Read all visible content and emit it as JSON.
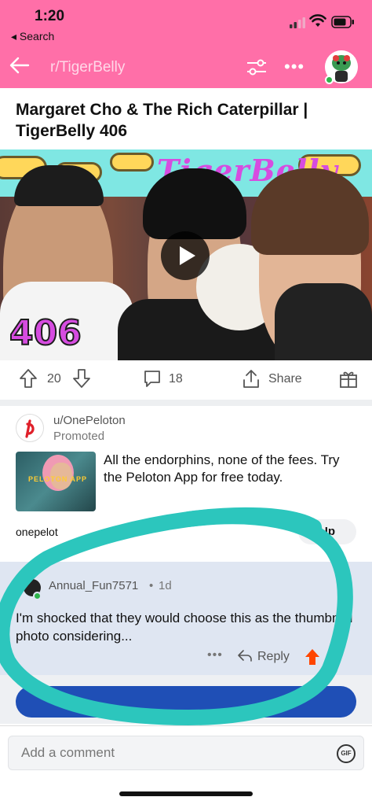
{
  "status_bar": {
    "time": "1:20",
    "back_label": "◂ Search"
  },
  "nav": {
    "subreddit": "r/TigerBelly"
  },
  "post": {
    "title": "Margaret Cho & The Rich Caterpillar | TigerBelly 406",
    "video_banner_text": "TigerBelly",
    "video_episode": "406",
    "upvotes": "20",
    "comments": "18",
    "share_label": "Share"
  },
  "ad": {
    "user": "u/OnePeloton",
    "promoted": "Promoted",
    "thumb_text": "PELOTON APP",
    "text": "All the endorphins, none of the fees. Try the Peloton App for free today.",
    "link": "onepelot",
    "cta": "Up"
  },
  "comment": {
    "user": "Annual_Fun7571",
    "dot": "•",
    "age": "1d",
    "body": "I'm shocked that they would choose this as the thumbnail photo considering...",
    "more": "•••",
    "reply": "Reply"
  },
  "composer": {
    "placeholder": "Add a comment",
    "gif": "GIF"
  },
  "colors": {
    "header": "#ff6fa8",
    "annotation": "#2cc6bd",
    "upvote_active": "#ff4500",
    "comment_bg": "#dfe6f2"
  }
}
